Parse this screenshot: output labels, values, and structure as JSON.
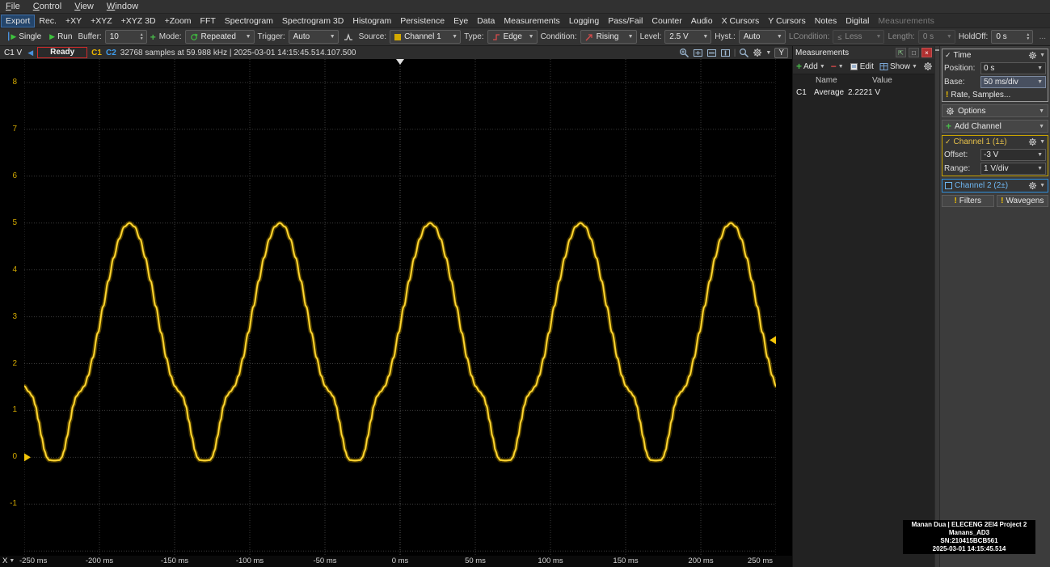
{
  "window": {
    "menu_items": [
      "File",
      "Control",
      "View",
      "Window"
    ]
  },
  "view_toolbar": {
    "items": [
      {
        "label": "Export",
        "active": true
      },
      {
        "label": "Rec."
      },
      {
        "label": "+XY"
      },
      {
        "label": "+XYZ"
      },
      {
        "label": "+XYZ 3D"
      },
      {
        "label": "+Zoom"
      },
      {
        "label": "FFT"
      },
      {
        "label": "Spectrogram"
      },
      {
        "label": "Spectrogram 3D"
      },
      {
        "label": "Histogram"
      },
      {
        "label": "Persistence"
      },
      {
        "label": "Eye"
      },
      {
        "label": "Data"
      },
      {
        "label": "Measurements"
      },
      {
        "label": "Logging"
      },
      {
        "label": "Pass/Fail"
      },
      {
        "label": "Counter"
      },
      {
        "label": "Audio"
      },
      {
        "label": "X Cursors"
      },
      {
        "label": "Y Cursors"
      },
      {
        "label": "Notes"
      },
      {
        "label": "Digital"
      },
      {
        "label": "Measurements",
        "disabled": true
      }
    ]
  },
  "control_toolbar": {
    "single_label": "Single",
    "run_label": "Run",
    "buffer_label": "Buffer:",
    "buffer_value": "10",
    "mode_label": "Mode:",
    "mode_value": "Repeated",
    "trigger_label": "Trigger:",
    "trigger_value": "Auto",
    "source_label": "Source:",
    "source_value": "Channel 1",
    "type_label": "Type:",
    "type_value": "Edge",
    "condition_label": "Condition:",
    "condition_value": "Rising",
    "level_label": "Level:",
    "level_value": "2.5 V",
    "hyst_label": "Hyst.:",
    "hyst_value": "Auto",
    "lcondition_label": "LCondition:",
    "lcondition_value": "Less",
    "length_label": "Length:",
    "length_value": "0 s",
    "holdoff_label": "HoldOff:",
    "holdoff_value": "0 s",
    "more_label": "..."
  },
  "status_bar": {
    "axis_label": "C1 V",
    "state": "Ready",
    "c1_label": "C1",
    "c2_label": "C2",
    "info": "32768 samples at 59.988 kHz | 2025-03-01 14:15:45.514.107.500",
    "y_button": "Y"
  },
  "plot_ui": {
    "x_button_label": "X"
  },
  "chart_data": {
    "type": "line",
    "x_range": [
      -250,
      250
    ],
    "x_ticks": [
      "-250 ms",
      "-200 ms",
      "-150 ms",
      "-100 ms",
      "-50 ms",
      "0 ms",
      "50 ms",
      "100 ms",
      "150 ms",
      "200 ms",
      "250 ms"
    ],
    "x_tick_values": [
      -250,
      -200,
      -150,
      -100,
      -50,
      0,
      50,
      100,
      150,
      200,
      250
    ],
    "y_ticks": [
      8,
      7,
      6,
      5,
      4,
      3,
      2,
      1,
      0,
      -1
    ],
    "grid_y_values": [
      8,
      7,
      6,
      5,
      4,
      3,
      2,
      1,
      0,
      -1,
      -2
    ],
    "y_top": 8.5,
    "y_bottom": -2.1,
    "time_base": "50 ms/div",
    "trigger_level": 2.5,
    "trigger_position_ms": 0,
    "channel_offset_marker": 0,
    "series": [
      {
        "name": "Channel 1",
        "color": "#f2c408",
        "glow_color": "#8a6c00",
        "period_ms": 100,
        "peak_at_ms": 20,
        "period_points": [
          [
            0.0,
            5.0
          ],
          [
            0.035,
            4.92
          ],
          [
            0.07,
            4.66
          ],
          [
            0.105,
            4.26
          ],
          [
            0.14,
            3.77
          ],
          [
            0.175,
            3.22
          ],
          [
            0.21,
            2.66
          ],
          [
            0.245,
            2.12
          ],
          [
            0.275,
            1.74
          ],
          [
            0.3,
            1.52
          ],
          [
            0.33,
            1.4
          ],
          [
            0.355,
            1.3
          ],
          [
            0.375,
            1.1
          ],
          [
            0.395,
            0.78
          ],
          [
            0.415,
            0.44
          ],
          [
            0.435,
            0.14
          ],
          [
            0.45,
            0.0
          ],
          [
            0.465,
            -0.06
          ],
          [
            0.5,
            -0.07
          ],
          [
            0.535,
            -0.06
          ],
          [
            0.55,
            0.0
          ],
          [
            0.565,
            0.14
          ],
          [
            0.585,
            0.44
          ],
          [
            0.605,
            0.78
          ],
          [
            0.625,
            1.1
          ],
          [
            0.645,
            1.3
          ],
          [
            0.67,
            1.4
          ],
          [
            0.7,
            1.52
          ],
          [
            0.725,
            1.74
          ],
          [
            0.755,
            2.12
          ],
          [
            0.79,
            2.66
          ],
          [
            0.825,
            3.22
          ],
          [
            0.86,
            3.77
          ],
          [
            0.895,
            4.26
          ],
          [
            0.93,
            4.66
          ],
          [
            0.965,
            4.92
          ],
          [
            1.0,
            5.0
          ]
        ]
      }
    ]
  },
  "measurements_panel": {
    "title": "Measurements",
    "add_label": "Add",
    "edit_label": "Edit",
    "show_label": "Show",
    "col_name": "Name",
    "col_value": "Value",
    "rows": [
      {
        "channel": "C1",
        "name": "Average",
        "value": "2.2221 V"
      }
    ]
  },
  "right_panel": {
    "time_group": {
      "title": "Time",
      "position_label": "Position:",
      "position_value": "0 s",
      "base_label": "Base:",
      "base_value": "50 ms/div"
    },
    "rate_button": "Rate, Samples...",
    "options_label": "Options",
    "add_channel_label": "Add Channel",
    "channel1": {
      "title": "Channel 1 (1±)",
      "offset_label": "Offset:",
      "offset_value": "-3 V",
      "range_label": "Range:",
      "range_value": "1 V/div",
      "color": "#d8ac00"
    },
    "channel2": {
      "title": "Channel 2 (2±)",
      "color": "#3aa0ff"
    },
    "filters_label": "Filters",
    "wavegens_label": "Wavegens"
  },
  "overlay_label": {
    "lines": [
      "Manan Dua | ELECENG 2EI4 Project 2",
      "Manans_AD3",
      "SN:210415BCB561",
      "2025-03-01 14:15:45.514"
    ]
  }
}
